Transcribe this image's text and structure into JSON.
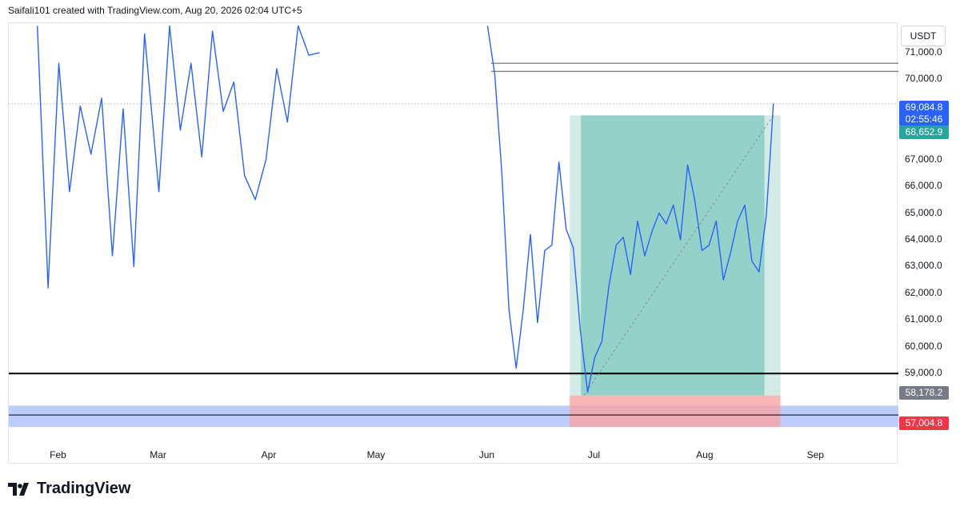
{
  "header": {
    "text": "Saifali101 created with TradingView.com, Aug 20, 2026 02:04 UTC+5"
  },
  "currency": "USDT",
  "brand": {
    "name": "TradingView",
    "icon": "tradingview-logo-icon"
  },
  "badges": {
    "last_price": "69,084.8",
    "countdown": "02:55:46",
    "target_price": "68,652.9",
    "entry_price": "58,178.2",
    "stop_price": "57,004.8"
  },
  "colors": {
    "candle": "#2962ff",
    "candle_dark": "#131722",
    "profit_zone": "#7fc9bf",
    "profit_zone_light": "#d2ebe7",
    "loss_zone": "#f7a4a4",
    "support_band": "#bcccfb",
    "last_price_badge": "#2962ff",
    "target_badge": "#26a69a",
    "entry_badge": "#787b86",
    "stop_badge": "#f23645"
  },
  "chart_data": {
    "type": "line",
    "title": "",
    "xlabel": "",
    "ylabel": "USDT",
    "ylim": [
      55600,
      72100
    ],
    "x_tick_labels": [
      "Feb",
      "Mar",
      "Apr",
      "May",
      "Jun",
      "Jul",
      "Aug",
      "Sep"
    ],
    "y_tick_labels": [
      "71,000.0",
      "70,000.0",
      "67,000.0",
      "66,000.0",
      "65,000.0",
      "64,000.0",
      "63,000.0",
      "62,000.0",
      "61,000.0",
      "60,000.0",
      "59,000.0"
    ],
    "y_tick_values": [
      71000,
      70000,
      67000,
      66000,
      65000,
      64000,
      63000,
      62000,
      61000,
      60000,
      59000
    ],
    "series": [
      {
        "x": [
          "Jan 26",
          "Jan 29",
          "Feb 1",
          "Feb 4",
          "Feb 7",
          "Feb 10",
          "Feb 13",
          "Feb 16",
          "Feb 19",
          "Feb 22",
          "Feb 25",
          "Mar 1",
          "Mar 4",
          "Mar 7",
          "Mar 10",
          "Mar 13",
          "Mar 16",
          "Mar 19",
          "Mar 22",
          "Mar 25",
          "Mar 28",
          "Mar 31",
          "Apr 3",
          "Apr 6",
          "Apr 9",
          "Apr 12",
          "Apr 15"
        ],
        "y": [
          72000,
          62200,
          70600,
          65800,
          69000,
          67200,
          69300,
          63400,
          68900,
          63000,
          71700,
          65800,
          72000,
          68100,
          70600,
          67100,
          71800,
          68800,
          69900,
          66400,
          65500,
          67000,
          70400,
          68400,
          72000,
          70900,
          71000
        ]
      },
      {
        "x": [
          "Jun 1",
          "Jun 3",
          "Jun 5",
          "Jun 7",
          "Jun 9",
          "Jun 11",
          "Jun 13",
          "Jun 15",
          "Jun 17",
          "Jun 19",
          "Jun 21",
          "Jun 23",
          "Jun 25",
          "Jun 27",
          "Jun 29",
          "Jul 1",
          "Jul 3",
          "Jul 5",
          "Jul 7",
          "Jul 9",
          "Jul 11",
          "Jul 13",
          "Jul 15",
          "Jul 17",
          "Jul 19",
          "Jul 21",
          "Jul 23",
          "Jul 25",
          "Jul 27",
          "Jul 29",
          "Jul 31",
          "Aug 2",
          "Aug 4",
          "Aug 6",
          "Aug 8",
          "Aug 10",
          "Aug 12",
          "Aug 14",
          "Aug 16",
          "Aug 18",
          "Aug 19",
          "Aug 20"
        ],
        "y": [
          72000,
          70200,
          66500,
          61400,
          59200,
          61400,
          64200,
          60900,
          63600,
          63800,
          66900,
          64400,
          63700,
          60600,
          58300,
          59600,
          60200,
          62300,
          63800,
          64100,
          62700,
          64700,
          63400,
          64300,
          65000,
          64600,
          65300,
          64000,
          66800,
          65500,
          63600,
          63800,
          64700,
          62500,
          63500,
          64700,
          65300,
          63200,
          62800,
          64900,
          66900,
          69100
        ]
      }
    ],
    "horizontal_levels": [
      70600,
      70300,
      69085,
      59000,
      57450
    ],
    "support_zone": [
      57000,
      57800
    ],
    "long_position": {
      "start": "Jun 24",
      "end": "Aug 22",
      "entry": 58178.2,
      "target": 68652.9,
      "stop": 57004.8
    }
  }
}
